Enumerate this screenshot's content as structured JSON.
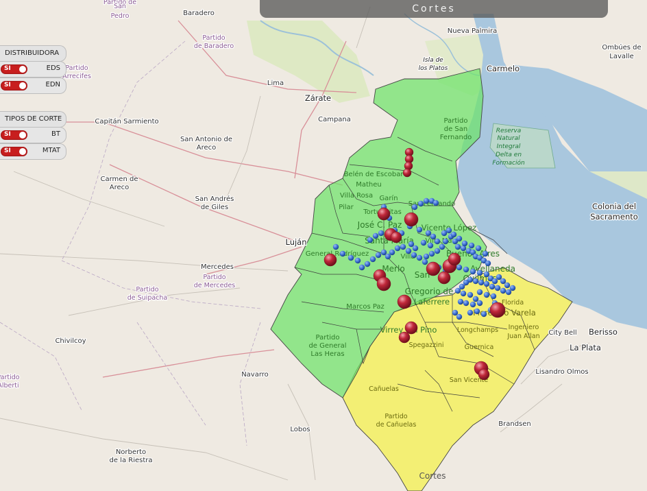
{
  "title": "Cortes",
  "panels": {
    "distribuidora": {
      "heading": "DISTRIBUIDORA",
      "items": [
        {
          "label": "EDS",
          "toggle": "SI"
        },
        {
          "label": "EDN",
          "toggle": "SI"
        }
      ]
    },
    "tipos": {
      "heading": "TIPOS DE CORTE",
      "items": [
        {
          "label": "BT",
          "toggle": "SI"
        },
        {
          "label": "MTAT",
          "toggle": "SI"
        }
      ]
    }
  },
  "places": {
    "san_pedro_1": "Partido de",
    "san_pedro_2": "San",
    "san_pedro_3": "Pedro",
    "baradero": "Baradero",
    "partido_baradero_1": "Partido",
    "partido_baradero_2": "de Baradero",
    "arrecifes_1": "Partido",
    "arrecifes_2": "Arrecifes",
    "lima": "Lima",
    "zarate": "Zárate",
    "campana": "Campana",
    "capitan_sarmiento": "Capitán Sarmiento",
    "san_antonio_1": "San Antonio de",
    "san_antonio_2": "Areco",
    "carmen_1": "Carmen de",
    "carmen_2": "Areco",
    "san_andres_1": "San Andrés",
    "san_andres_2": "de Giles",
    "lujan": "Luján",
    "mercedes": "Mercedes",
    "partido_mercedes_1": "Partido",
    "partido_mercedes_2": "de Mercedes",
    "suipacha_1": "Partido",
    "suipacha_2": "de Suipacha",
    "chivilcoy": "Chivilcoy",
    "alberti_1": "Partido",
    "alberti_2": "Alberti",
    "navarro": "Navarro",
    "lobos": "Lobos",
    "norberto_1": "Norberto",
    "norberto_2": "de la Riestra",
    "nueva_palmira": "Nueva Palmira",
    "isla_1": "Isla de",
    "isla_2": "los Platos",
    "carmelo": "Carmelo",
    "ombues_1": "Ombúes de",
    "ombues_2": "Lavalle",
    "colonia_1": "Colonia del",
    "colonia_2": "Sacramento",
    "reserva_1": "Reserva",
    "reserva_2": "Natural",
    "reserva_3": "Integral",
    "reserva_4": "Delta en",
    "reserva_5": "Formación",
    "city_bell": "City Bell",
    "berisso": "Berisso",
    "la_plata": "La Plata",
    "lisandro": "Lisandro Olmos",
    "brandsen": "Brandsen",
    "san_fernando_1": "Partido",
    "san_fernando_2": "de San",
    "san_fernando_3": "Fernando",
    "belen": "Belén de Escobar",
    "matheu": "Matheu",
    "villa_rosa": "Villa Rosa",
    "garin": "Garín",
    "pilar": "Pilar",
    "tortuguitas": "Tortuguitas",
    "san_fernando_city": "San Fernando",
    "jose_c_paz": "José C. Paz",
    "vicente_lopez": "Vicente López",
    "santa_maria": "Santa María",
    "villa_ma": "Villa Ma",
    "general_rodriguez": "General Rodríguez",
    "villa": "Villa",
    "merlo": "Merlo",
    "buenos_aires": "Buenos Aires",
    "quilmes": "Quilmes",
    "avellaneda": "Avellaneda",
    "san": "San",
    "gregorio_1": "Gregorio de",
    "gregorio_2": "Laferrere",
    "marcos_paz": "Marcos Paz",
    "florida": "Florida",
    "florencio": "Florencio Varela",
    "virrey": "Virrey del Pino",
    "lomachamps": "Longchamps",
    "ingeniero_1": "Ingeniero",
    "ingeniero_2": "Juan Allan",
    "spegazzini": "Spegazzini",
    "guernica": "Guernica",
    "las_heras_1": "Partido",
    "las_heras_2": "de General",
    "las_heras_3": "Las Heras",
    "san_vicente": "San Vicente",
    "canuelas": "Cañuelas",
    "canuelas_p_1": "Partido",
    "canuelas_p_2": "de Cañuelas",
    "cortes_label": "Cortes"
  },
  "colors": {
    "edn_zone": "#6ee36a",
    "eds_zone": "#f3ef55",
    "water": "#a9c7de",
    "cut_bt": "#3b6fd1",
    "cut_mtat": "#c0283a",
    "toggle_on": "#c81e1e"
  },
  "markers": {
    "blue_count_hint": "many",
    "red_count_hint": "many"
  }
}
